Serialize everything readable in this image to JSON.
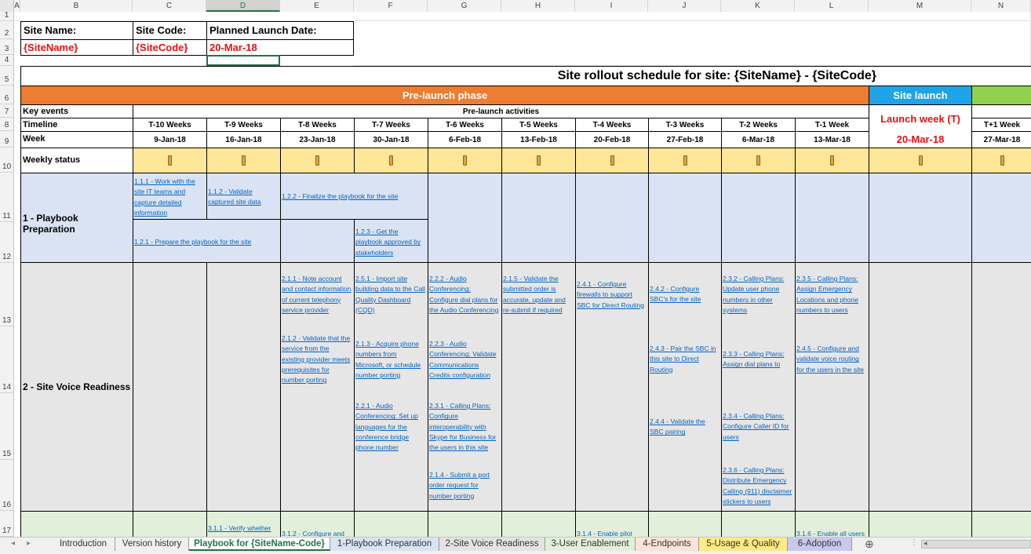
{
  "columns": [
    "A",
    "B",
    "C",
    "D",
    "E",
    "F",
    "G",
    "H",
    "I",
    "J",
    "K",
    "L",
    "M",
    "N"
  ],
  "rows": [
    "1",
    "2",
    "3",
    "4",
    "5",
    "6",
    "7",
    "8",
    "9",
    "10",
    "11",
    "12",
    "13",
    "14",
    "15",
    "16",
    "17"
  ],
  "site_info": {
    "site_name_label": "Site Name:",
    "site_code_label": "Site Code:",
    "launch_date_label": "Planned Launch Date:",
    "site_name_value": "{SiteName}",
    "site_code_value": "{SiteCode}",
    "launch_date_value": "20-Mar-18"
  },
  "schedule_title": "Site rollout schedule for site: {SiteName} - {SiteCode}",
  "phases": {
    "prelaunch": "Pre-launch phase",
    "launch": "Site launch"
  },
  "row_labels": {
    "key_events": "Key events",
    "timeline": "Timeline",
    "week": "Week",
    "weekly_status": "Weekly status",
    "playbook": "1 - Playbook Preparation",
    "voice": "2 - Site Voice Readiness"
  },
  "prelaunch_activities": "Pre-launch activities",
  "launch_week": {
    "label": "Launch week (T)",
    "date": "20-Mar-18"
  },
  "timeline": [
    "T-10 Weeks",
    "T-9 Weeks",
    "T-8 Weeks",
    "T-7 Weeks",
    "T-6 Weeks",
    "T-5 Weeks",
    "T-4 Weeks",
    "T-3 Weeks",
    "T-2 Weeks",
    "T-1 Week",
    "T+1 Week"
  ],
  "weeks": [
    "9-Jan-18",
    "16-Jan-18",
    "23-Jan-18",
    "30-Jan-18",
    "6-Feb-18",
    "13-Feb-18",
    "20-Feb-18",
    "27-Feb-18",
    "6-Mar-18",
    "13-Mar-18",
    "27-Mar-18"
  ],
  "tasks": {
    "t111": "1.1.1 - Work with the site IT teams and capture detailed information",
    "t112": "1.1.2 - Validate captured site data",
    "t122": "1.2.2 - Finalize the playbook for the site",
    "t121": "1.2.1 - Prepare the playbook for the site",
    "t123": "1.2.3 - Get the playbook approved by stakeholders",
    "t211": "2.1.1 - Note account and contact information of current telephony service provider",
    "t212": "2.1.2 - Validate that the service from the existing provider meets prerequisites for number porting",
    "t251": "2.5.1 - Import site building data to the Call Quality Dashboard (CQD)",
    "t213": "2.1.3 - Acquire phone numbers from Microsoft, or schedule number porting",
    "t221": "2.2.1 - Audio Conferencing: Set up languages for the conference bridge phone number",
    "t222": "2.2.2 - Audio Conferencing: Configure dial plans for the Audio Conferencing bridge",
    "t223": "2.2.3 - Audio Conferencing: Validate Communications Credits configuration",
    "t231": "2.3.1 - Calling Plans: Configure interoperability with Skype for Business for the users in this site",
    "t214": "2.1.4 - Submit a port order request for number porting",
    "t215": "2.1.5 - Validate the submitted order is accurate, update and re-submit if required",
    "t241": "2.4.1 - Configure firewalls to support SBC for Direct Routing",
    "t242": "2.4.2 - Configure SBC's for the site",
    "t243": "2.4.3 - Pair the SBC in this site to Direct Routing",
    "t244": "2.4.4 - Validate the SBC pairing",
    "t232": "2.3.2 - Calling Plans: Update user phone numbers in other systems",
    "t233": "2.3.3 - Calling Plans: Assign dial plans to users",
    "t234": "2.3.4 - Calling Plans: Configure Caller ID for users",
    "t236": "2.3.6 - Calling Plans: Distribute Emergency Calling (911) disclaimer stickers to users",
    "t235": "2.3.5 - Calling Plans: Assign Emergency Locations and phone numbers to users",
    "t245": "2.4.5 - Configure and validate voice routing for the users in the site",
    "t311": "3.1.1 - Verify whether",
    "t312": "3.1.2 - Configure and",
    "t314": "3.1.4 - Enable pilot users",
    "t316": "3.1.6 - Enable all users"
  },
  "tabs": [
    {
      "label": "Introduction",
      "color": "#f0f0f0"
    },
    {
      "label": "Version history",
      "color": "#f0f0f0"
    },
    {
      "label": "Playbook for {SiteName-Code}",
      "color": "#ffffff"
    },
    {
      "label": "1-Playbook Preparation",
      "color": "#dae3f3"
    },
    {
      "label": "2-Site Voice Readiness",
      "color": "#e3e3e3"
    },
    {
      "label": "3-User Enablement",
      "color": "#e2efda"
    },
    {
      "label": "4-Endpoints",
      "color": "#fce4d6"
    },
    {
      "label": "5-Usage & Quality",
      "color": "#ffeb84"
    },
    {
      "label": "6-Adoption",
      "color": "#c9c9ef"
    }
  ],
  "colors": {
    "orange": "#ed7d31",
    "blue_launch": "#1fa3e8",
    "green_post": "#92d050",
    "status_yellow": "#ffe699",
    "playbook_blue": "#dae3f3",
    "voice_gray": "#e7e6e6",
    "user_green": "#e2efda"
  }
}
